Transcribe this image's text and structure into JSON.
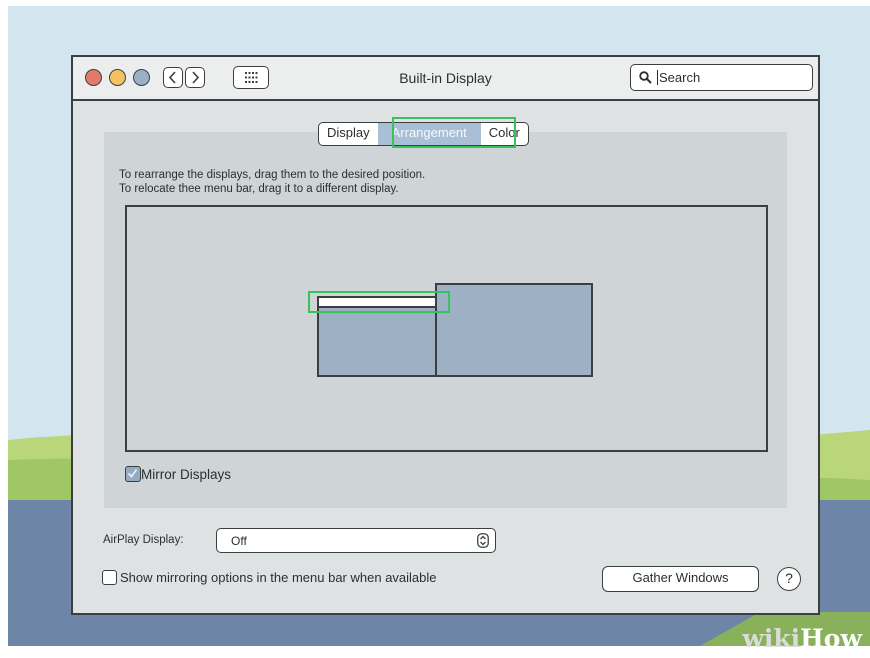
{
  "window": {
    "title": "Built-in Display",
    "search_placeholder": "Search"
  },
  "tabs": [
    {
      "label": "Display",
      "active": false
    },
    {
      "label": "Arrangement",
      "active": true
    },
    {
      "label": "Color",
      "active": false
    }
  ],
  "instructions": {
    "line1": "To rearrange the displays, drag them to the desired position.",
    "line2": "To relocate thee menu bar, drag it to a different display."
  },
  "mirror_displays": {
    "label": "Mirror Displays",
    "checked": true
  },
  "airplay": {
    "label": "AirPlay Display:",
    "value": "Off"
  },
  "show_mirroring": {
    "label": "Show mirroring options in the menu bar when available",
    "checked": false
  },
  "gather_windows_label": "Gather Windows",
  "help_label": "?",
  "watermark": {
    "part1": "wiki",
    "part2": "How"
  },
  "colors": {
    "highlight": "#39c15b",
    "display_fill": "#9eb0c3",
    "active_tab": "#a9bfd6"
  }
}
